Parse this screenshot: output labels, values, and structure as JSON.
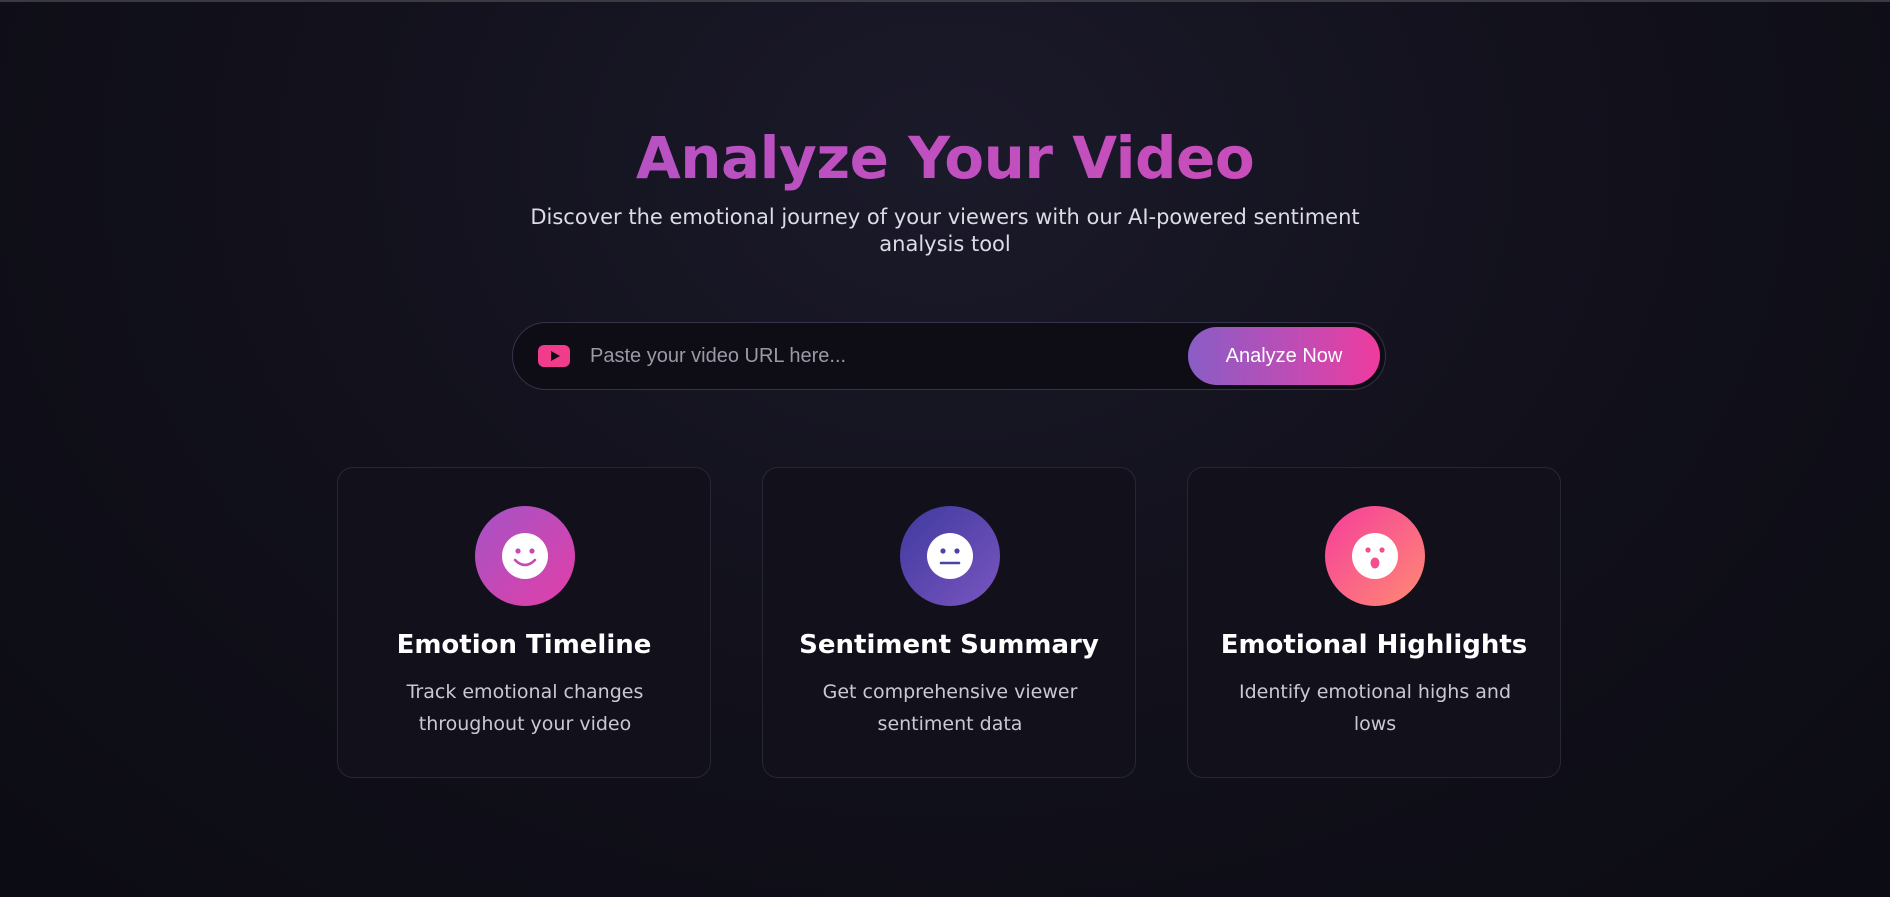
{
  "hero": {
    "title": "Analyze Your Video",
    "subtitle": "Discover the emotional journey of your viewers with our AI-powered sentiment analysis tool"
  },
  "search": {
    "icon": "youtube-play-icon",
    "placeholder": "Paste your video URL here...",
    "value": "",
    "button_label": "Analyze Now"
  },
  "features": [
    {
      "icon": "smile-face-icon",
      "title": "Emotion Timeline",
      "description": "Track emotional changes throughout your video",
      "gradient": [
        "#a453c6",
        "#e23fa8"
      ]
    },
    {
      "icon": "neutral-face-icon",
      "title": "Sentiment Summary",
      "description": "Get comprehensive viewer sentiment data",
      "gradient": [
        "#3e3a9e",
        "#7a55c0"
      ]
    },
    {
      "icon": "surprised-face-icon",
      "title": "Emotional Highlights",
      "description": "Identify emotional highs and lows",
      "gradient": [
        "#f53d9c",
        "#ff8a72"
      ]
    }
  ],
  "colors": {
    "background": "#12111c",
    "accent_pink": "#f03c8a",
    "accent_purple": "#a856c9"
  }
}
